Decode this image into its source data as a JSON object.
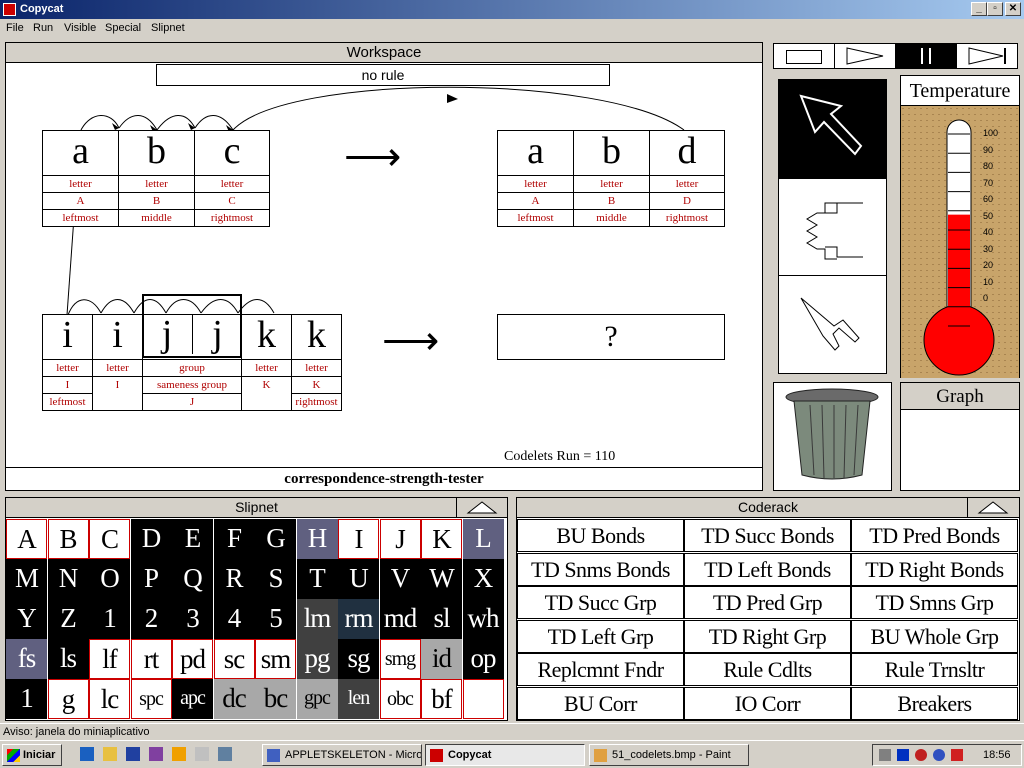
{
  "window": {
    "title": "Copycat",
    "btn_min": "_",
    "btn_max": "▫",
    "btn_close": "✕"
  },
  "menu": [
    "File",
    "Run",
    "Visible",
    "Special",
    "Slipnet"
  ],
  "workspace": {
    "title": "Workspace",
    "rule": "no rule",
    "arrow": "⟶",
    "question": "?",
    "codelets": "Codelets Run = 110",
    "status": "correspondence-strength-tester",
    "initial": {
      "letters": [
        "a",
        "b",
        "c"
      ],
      "types": [
        "letter",
        "letter",
        "letter"
      ],
      "cats": [
        "A",
        "B",
        "C"
      ],
      "pos": [
        "leftmost",
        "middle",
        "rightmost"
      ]
    },
    "modified": {
      "letters": [
        "a",
        "b",
        "d"
      ],
      "types": [
        "letter",
        "letter",
        "letter"
      ],
      "cats": [
        "A",
        "B",
        "D"
      ],
      "pos": [
        "leftmost",
        "middle",
        "rightmost"
      ]
    },
    "target": {
      "letters": [
        "i",
        "i",
        "j",
        "j",
        "k",
        "k"
      ],
      "types": [
        "letter",
        "letter",
        "group",
        "letter",
        "letter"
      ],
      "cats": [
        "I",
        "I",
        "sameness group",
        "K",
        "K"
      ],
      "pos": [
        "leftmost",
        "J",
        "rightmost"
      ]
    }
  },
  "controls": {
    "temperature_title": "Temperature",
    "graph_title": "Graph",
    "temperature_value": 58,
    "scale": [
      "100",
      "90",
      "80",
      "70",
      "60",
      "50",
      "40",
      "30",
      "20",
      "10",
      "0"
    ]
  },
  "slipnet": {
    "title": "Slipnet",
    "cells": [
      [
        "A",
        "w"
      ],
      [
        "B",
        "w"
      ],
      [
        "C",
        "w"
      ],
      [
        "D",
        "k"
      ],
      [
        "E",
        "k"
      ],
      [
        "F",
        "k"
      ],
      [
        "G",
        "k"
      ],
      [
        "H",
        "g"
      ],
      [
        "I",
        "w"
      ],
      [
        "J",
        "w"
      ],
      [
        "K",
        "w"
      ],
      [
        "L",
        "g"
      ],
      [
        "M",
        "k"
      ],
      [
        "N",
        "k"
      ],
      [
        "O",
        "k"
      ],
      [
        "P",
        "k"
      ],
      [
        "Q",
        "k"
      ],
      [
        "R",
        "k"
      ],
      [
        "S",
        "k"
      ],
      [
        "T",
        "k"
      ],
      [
        "U",
        "k"
      ],
      [
        "V",
        "k"
      ],
      [
        "W",
        "k"
      ],
      [
        "X",
        "k"
      ],
      [
        "Y",
        "k"
      ],
      [
        "Z",
        "k"
      ],
      [
        "1",
        "k"
      ],
      [
        "2",
        "k"
      ],
      [
        "3",
        "k"
      ],
      [
        "4",
        "k"
      ],
      [
        "5",
        "k"
      ],
      [
        "lm",
        "d"
      ],
      [
        "rm",
        "n"
      ],
      [
        "md",
        "k"
      ],
      [
        "sl",
        "k"
      ],
      [
        "wh",
        "k"
      ],
      [
        "fs",
        "g"
      ],
      [
        "ls",
        "k"
      ],
      [
        "lf",
        "w"
      ],
      [
        "rt",
        "w"
      ],
      [
        "pd",
        "w"
      ],
      [
        "sc",
        "w"
      ],
      [
        "sm",
        "w"
      ],
      [
        "pg",
        "d"
      ],
      [
        "sg",
        "k"
      ],
      [
        "smg",
        "w"
      ],
      [
        "id",
        "s"
      ],
      [
        "op",
        "k"
      ],
      [
        "1",
        "k"
      ],
      [
        "g",
        "w"
      ],
      [
        "lc",
        "w"
      ],
      [
        "spc",
        "w"
      ],
      [
        "apc",
        "k"
      ],
      [
        "dc",
        "s"
      ],
      [
        "bc",
        "s"
      ],
      [
        "gpc",
        "s"
      ],
      [
        "len",
        "d"
      ],
      [
        "obc",
        "w"
      ],
      [
        "bf",
        "w"
      ],
      [
        "",
        "w"
      ]
    ]
  },
  "coderack": {
    "title": "Coderack",
    "items": [
      "BU Bonds",
      "TD Succ Bonds",
      "TD Pred Bonds",
      "TD Snms Bonds",
      "TD Left Bonds",
      "TD Right Bonds",
      "TD Succ Grp",
      "TD Pred Grp",
      "TD Smns Grp",
      "TD Left Grp",
      "TD Right Grp",
      "BU Whole Grp",
      "Replcmnt Fndr",
      "Rule Cdlts",
      "Rule Trnsltr",
      "BU Corr",
      "IO Corr",
      "Breakers"
    ]
  },
  "statusbar": "Aviso: janela do miniaplicativo",
  "taskbar": {
    "start": "Iniciar",
    "tasks": [
      "APPLETSKELETON - Micro...",
      "Copycat",
      "51_codelets.bmp - Paint"
    ],
    "clock": "18:56"
  }
}
